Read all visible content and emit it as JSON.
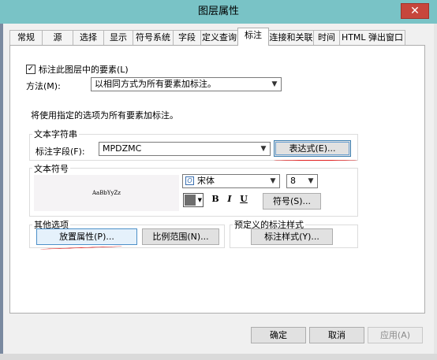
{
  "window": {
    "title": "图层属性",
    "close_glyph": "✕"
  },
  "tabs": [
    "常规",
    "源",
    "选择",
    "显示",
    "符号系统",
    "字段",
    "定义查询",
    "标注",
    "连接和关联",
    "时间",
    "HTML 弹出窗口"
  ],
  "label_check": {
    "checked": true,
    "label": "标注此图层中的要素(L)"
  },
  "method": {
    "label": "方法(M):",
    "value": "以相同方式为所有要素加标注。"
  },
  "info_text": "将使用指定的选项为所有要素加标注。",
  "text_string": {
    "group_title": "文本字符串",
    "field_label": "标注字段(F):",
    "field_value": "MPDZMC",
    "expression_button": "表达式(E)..."
  },
  "text_symbol": {
    "group_title": "文本符号",
    "preview_text": "AaBbYyZz",
    "font_value": "宋体",
    "size_value": "8",
    "bold": "B",
    "italic": "I",
    "underline": "U",
    "symbol_button": "符号(S)..."
  },
  "other_options": {
    "group_title": "其他选项",
    "placement_button": "放置属性(P)...",
    "scale_button": "比例范围(N)..."
  },
  "predefined": {
    "group_title": "预定义的标注样式",
    "style_button": "标注样式(Y)..."
  },
  "footer": {
    "ok": "确定",
    "cancel": "取消",
    "apply": "应用(A)"
  },
  "colors": {
    "titlebar": "#79c3c6",
    "close": "#c7463c",
    "annotation_red": "#e02020",
    "symbol_color": "#6e6e6e"
  }
}
